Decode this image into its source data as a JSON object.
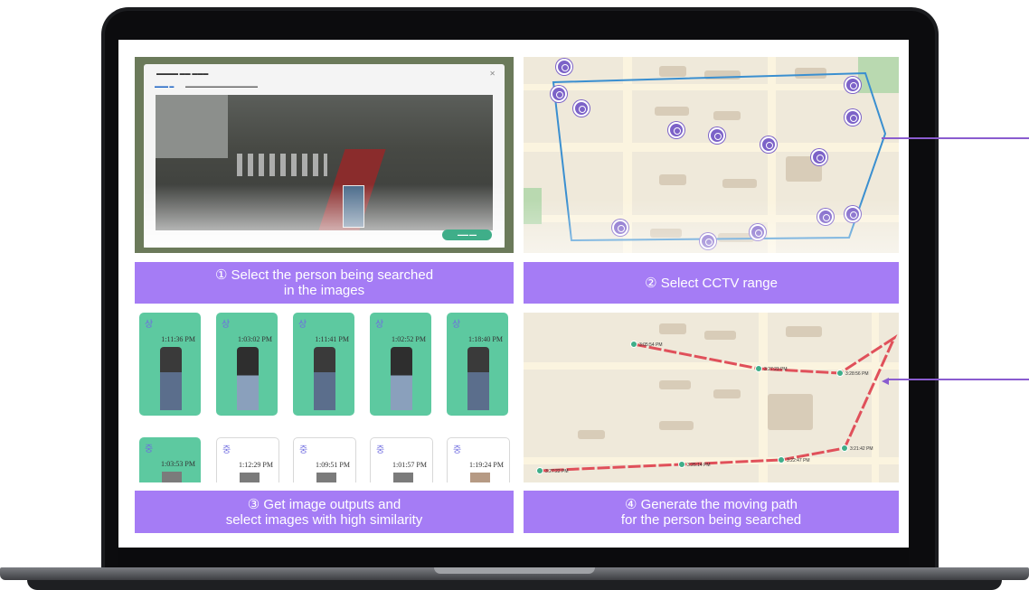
{
  "steps": [
    {
      "caption_line1": "① Select the person being searched",
      "caption_line2": "in the images"
    },
    {
      "caption_line1": "② Select CCTV range",
      "caption_line2": ""
    },
    {
      "caption_line1": "③ Get image outputs and",
      "caption_line2": "select images with high similarity"
    },
    {
      "caption_line1": "④ Generate the moving path",
      "caption_line2": "for the person being searched"
    }
  ],
  "cards_top": [
    {
      "badge": "상",
      "time": "1:11:36 PM"
    },
    {
      "badge": "상",
      "time": "1:03:02 PM"
    },
    {
      "badge": "상",
      "time": "1:11:41 PM"
    },
    {
      "badge": "상",
      "time": "1:02:52 PM"
    },
    {
      "badge": "상",
      "time": "1:18:40 PM"
    }
  ],
  "cards_bottom": [
    {
      "badge": "중",
      "time": "1:03:53 PM"
    },
    {
      "badge": "중",
      "time": "1:12:29 PM"
    },
    {
      "badge": "중",
      "time": "1:09:51 PM"
    },
    {
      "badge": "중",
      "time": "1:01:57 PM"
    },
    {
      "badge": "중",
      "time": "1:19:24 PM"
    }
  ],
  "path_labels": [
    "3:05:54 PM",
    "3:27:23 PM",
    "3:28:56 PM",
    "3:21:42 PM",
    "3:22:47 PM",
    "3:25:14 PM",
    "3:27:22 PM"
  ],
  "colors": {
    "caption_bg": "#a57cf5",
    "card_green": "#5dc9a0",
    "path_red": "#e0505a",
    "range_blue": "#3a8fd0",
    "marker_purple": "#7c62c8"
  }
}
